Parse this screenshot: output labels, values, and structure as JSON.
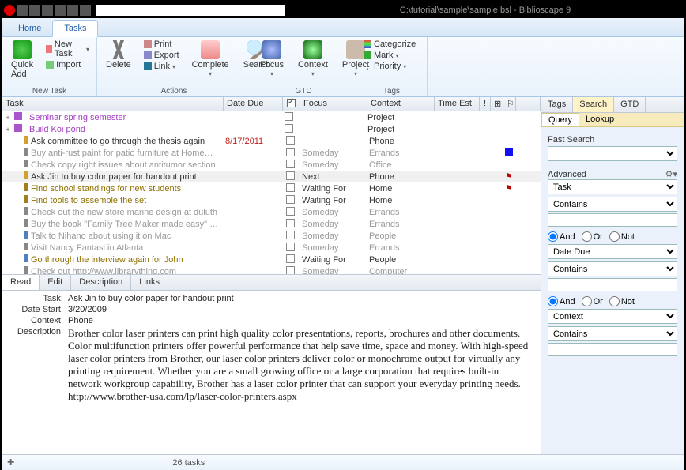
{
  "window": {
    "title": "C:\\tutorial\\sample\\sample.bsl - Biblioscape 9"
  },
  "menu": {
    "home": "Home",
    "tasks": "Tasks"
  },
  "ribbon": {
    "newtask_grp": "New Task",
    "actions_grp": "Actions",
    "gtd_grp": "GTD",
    "tags_grp": "Tags",
    "quick_add": "Quick\nAdd",
    "new_task": "New Task",
    "import": "Import",
    "delete": "Delete",
    "print": "Print",
    "export": "Export",
    "link": "Link",
    "complete": "Complete",
    "search": "Search",
    "focus": "Focus",
    "context": "Context",
    "project": "Project",
    "categorize": "Categorize",
    "mark": "Mark",
    "priority": "Priority"
  },
  "grid_headers": {
    "task": "Task",
    "date_due": "Date Due",
    "focus": "Focus",
    "context": "Context",
    "time_est": "Time Est"
  },
  "tasks": [
    {
      "exp": "+",
      "name": "Seminar spring semester",
      "due": "",
      "focus": "",
      "context": "Project",
      "color": "#a040c0"
    },
    {
      "exp": "+",
      "name": "Build Koi pond",
      "due": "",
      "focus": "",
      "context": "Project",
      "color": "#a040c0"
    },
    {
      "icon": "#d0a030",
      "name": "Ask committee to go through the thesis again",
      "due": "8/17/2011",
      "due_color": "#c02020",
      "focus": "",
      "context": "Phone"
    },
    {
      "icon": "#888",
      "name": "Buy anti-rust paint for patio furniture at HomeDepot",
      "due": "",
      "focus": "Someday",
      "context": "Errands",
      "dim": true,
      "flag": "blue"
    },
    {
      "icon": "#888",
      "name": "Check copy right issues about antitumor section",
      "due": "",
      "focus": "Someday",
      "context": "Office",
      "dim": true
    },
    {
      "icon": "#d0a030",
      "name": "Ask Jin to buy color paper for handout print",
      "due": "",
      "focus": "Next",
      "context": "Phone",
      "sel": true,
      "flag": "red"
    },
    {
      "icon": "#a08020",
      "name": "Find school standings for new students",
      "due": "",
      "focus": "Waiting For",
      "context": "Home",
      "color": "#907000",
      "flag": "red"
    },
    {
      "icon": "#a08020",
      "name": "Find tools to assemble the set",
      "due": "",
      "focus": "Waiting For",
      "context": "Home",
      "color": "#907000"
    },
    {
      "icon": "#888",
      "name": "Check out the new store marine design at duluth",
      "due": "",
      "focus": "Someday",
      "context": "Errands",
      "dim": true
    },
    {
      "icon": "#888",
      "name": "Buy the book \"Family Tree Maker made easy\" at Bord...",
      "due": "",
      "focus": "Someday",
      "context": "Errands",
      "dim": true
    },
    {
      "icon": "#5080c0",
      "name": "Talk to Nihano about using it on Mac",
      "due": "",
      "focus": "Someday",
      "context": "People",
      "dim": true
    },
    {
      "icon": "#888",
      "name": "Visit Nancy Fantasi in Atlanta",
      "due": "",
      "focus": "Someday",
      "context": "Errands",
      "dim": true
    },
    {
      "icon": "#5080c0",
      "name": "Go through the interview again for John",
      "due": "",
      "focus": "Waiting For",
      "context": "People",
      "color": "#907000"
    },
    {
      "icon": "#888",
      "name": "Check out http://www.librarything.com",
      "due": "",
      "focus": "Someday",
      "context": "Computer",
      "dim": true
    }
  ],
  "detail_tabs": {
    "read": "Read",
    "edit": "Edit",
    "description": "Description",
    "links": "Links"
  },
  "detail": {
    "task_k": "Task:",
    "task_v": "Ask Jin to buy color paper for handout print",
    "date_k": "Date Start:",
    "date_v": "3/20/2009",
    "ctx_k": "Context:",
    "ctx_v": "Phone",
    "desc_k": "Description:",
    "desc_v": "Brother color laser printers can print high quality color presentations, reports, brochures and other documents. Color multifunction printers offer powerful performance that help save time, space and money. With high-speed laser color printers from Brother, our laser color printers deliver color or monochrome output for virtually any printing requirement. Whether you are a small growing office or a large corporation that requires built-in network workgroup capability, Brother has a laser color printer that can support your everyday printing needs.\nhttp://www.brother-usa.com/lp/laser-color-printers.aspx"
  },
  "status": {
    "count": "26  tasks"
  },
  "side": {
    "tabs": {
      "tags": "Tags",
      "search": "Search",
      "gtd": "GTD"
    },
    "subtabs": {
      "query": "Query",
      "lookup": "Lookup"
    },
    "fast": "Fast Search",
    "advanced": "Advanced",
    "field_task": "Task",
    "field_date_due": "Date Due",
    "field_context": "Context",
    "op_contains": "Contains",
    "r_and": "And",
    "r_or": "Or",
    "r_not": "Not"
  }
}
